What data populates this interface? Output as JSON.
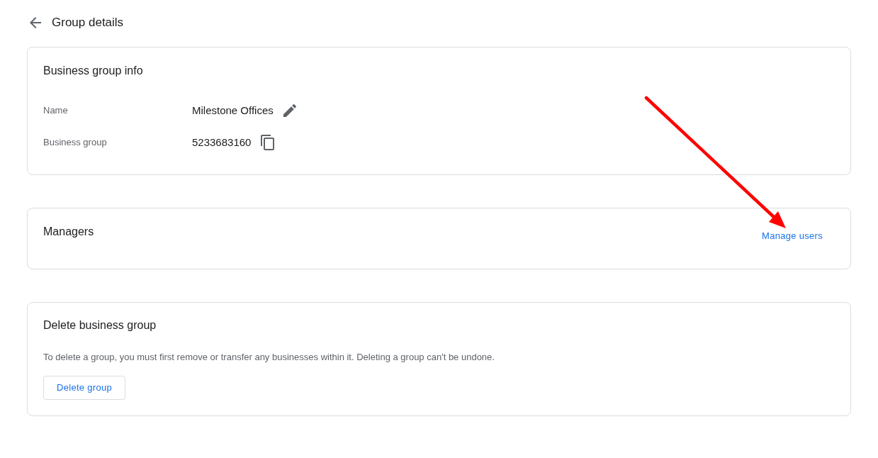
{
  "header": {
    "title": "Group details"
  },
  "info_card": {
    "title": "Business group info",
    "rows": [
      {
        "label": "Name",
        "value": "Milestone Offices",
        "kind": "edit"
      },
      {
        "label": "Business group",
        "value": "5233683160",
        "kind": "copy"
      }
    ]
  },
  "managers_card": {
    "title": "Managers",
    "link": "Manage users"
  },
  "delete_card": {
    "title": "Delete business group",
    "description": "To delete a group, you must first remove or transfer any businesses within it. Deleting a group can't be undone.",
    "button": "Delete group"
  },
  "annotations": [
    {
      "kind": "arrow"
    }
  ]
}
